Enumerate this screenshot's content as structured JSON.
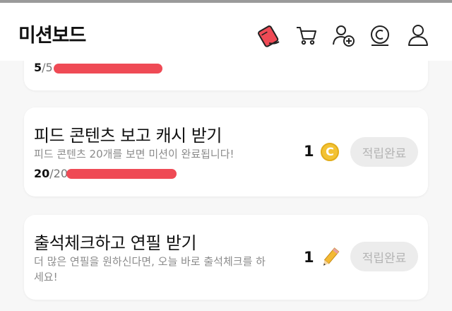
{
  "header": {
    "title": "미션보드",
    "icons": [
      "ticket-icon",
      "cart-icon",
      "add-friend-icon",
      "cash-coin-icon",
      "profile-icon"
    ]
  },
  "missions": [
    {
      "progress_current": "5",
      "progress_total": "/5",
      "progress_fraction": 1.0
    },
    {
      "title": "피드 콘텐츠 보고 캐시 받기",
      "description": "피드 콘텐츠 20개를 보면 미션이 완료됩니다!",
      "progress_current": "20",
      "progress_total": "/20",
      "progress_fraction": 1.0,
      "reward_amount": "1",
      "reward_icon": "coin-icon",
      "reward_coin_letter": "C",
      "button_label": "적립완료"
    },
    {
      "title": "출석체크하고 연필 받기",
      "description": "더 많은 연필을 원하신다면, 오늘 바로 출석체크를 하세요!",
      "reward_amount": "1",
      "reward_icon": "pencil-icon",
      "button_label": "적립완료"
    }
  ],
  "colors": {
    "accent": "#ef4a55",
    "coin": "#f3c233",
    "button_bg": "#ececec",
    "button_text": "#b4b4b4"
  }
}
